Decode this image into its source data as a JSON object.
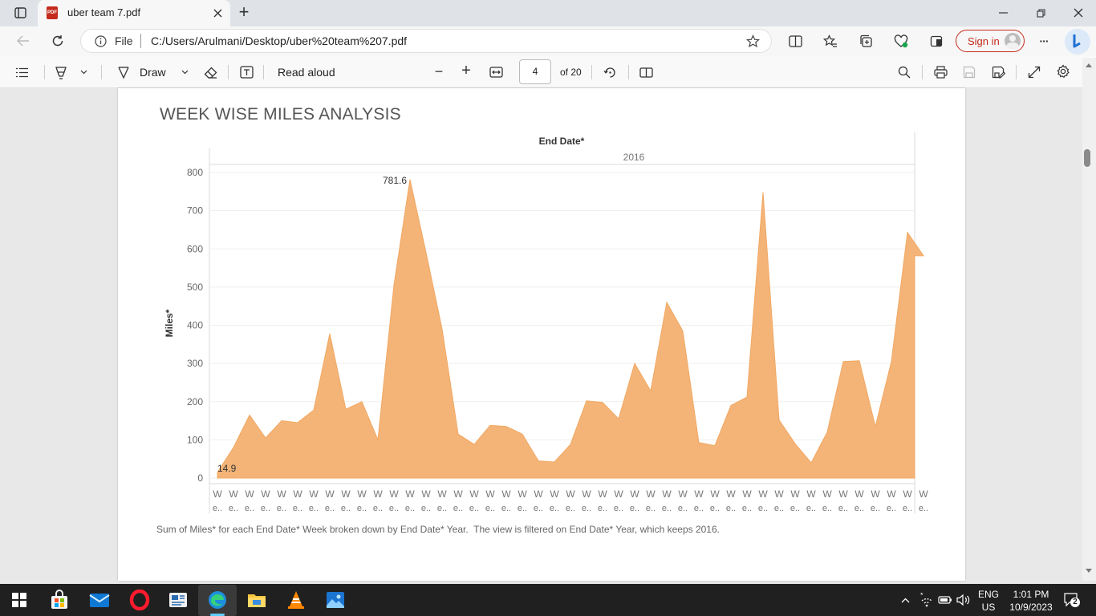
{
  "browser": {
    "tab_title": "uber team 7.pdf",
    "new_tab_symbol": "+",
    "address_scheme_label": "File",
    "address_url": "C:/Users/Arulmani/Desktop/uber%20team%207.pdf",
    "sign_in_label": "Sign in",
    "more_symbol": "···"
  },
  "pdf_toolbar": {
    "draw_label": "Draw",
    "read_aloud_label": "Read aloud",
    "page_number": "4",
    "page_total": "of 20",
    "zoom_out_symbol": "−",
    "zoom_in_symbol": "+"
  },
  "document": {
    "section_title": "WEEK WISE MILES ANALYSIS",
    "caption": "Sum of Miles* for each End Date* Week broken down by End Date* Year.  The view is filtered on End Date* Year, which keeps 2016."
  },
  "chart_data": {
    "type": "area",
    "column_header": "End Date*",
    "column_value": "2016",
    "ylabel": "Miles*",
    "ylim": [
      0,
      800
    ],
    "yticks": [
      "0",
      "100",
      "200",
      "300",
      "400",
      "500",
      "600",
      "700",
      "800"
    ],
    "grid": true,
    "color": "#f4b478",
    "x_tick_line1": "W",
    "x_tick_line2": "e..",
    "series": [
      {
        "values": [
          14.9,
          80,
          165,
          105,
          150,
          145,
          178,
          378,
          180,
          200,
          100,
          505,
          781.6,
          590,
          390,
          115,
          88,
          138,
          135,
          115,
          45,
          42,
          88,
          202,
          198,
          155,
          300,
          228,
          460,
          385,
          93,
          85,
          190,
          212,
          748,
          152,
          90,
          40,
          120,
          305,
          307,
          135,
          305,
          643,
          582
        ]
      }
    ],
    "labels": [
      {
        "index": 0,
        "text": "14.9"
      },
      {
        "index": 12,
        "text": "781.6"
      }
    ]
  },
  "taskbar": {
    "language_line1": "ENG",
    "language_line2": "US",
    "time": "1:01 PM",
    "date": "10/9/2023",
    "notification_count": "2"
  }
}
